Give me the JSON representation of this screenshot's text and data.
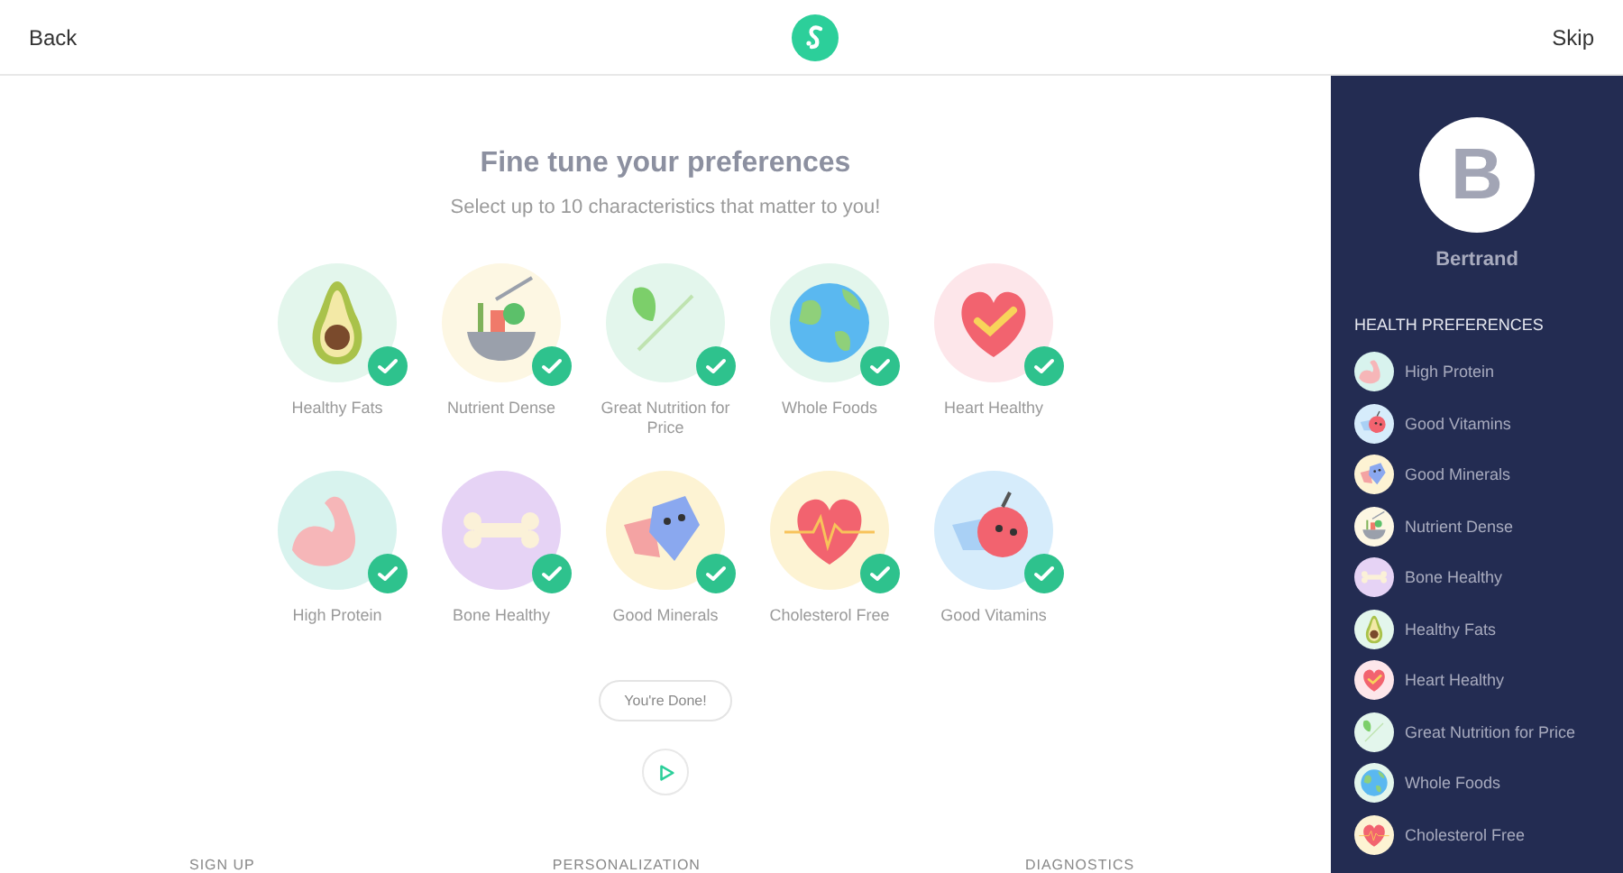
{
  "header": {
    "back": "Back",
    "skip": "Skip"
  },
  "main": {
    "title": "Fine tune your preferences",
    "subtitle": "Select up to 10 characteristics that matter to you!",
    "options": [
      {
        "label": "Healthy Fats",
        "kind": "avocado",
        "selected": true
      },
      {
        "label": "Nutrient Dense",
        "kind": "salad",
        "selected": true
      },
      {
        "label": "Great Nutrition for Price",
        "kind": "greens",
        "selected": true
      },
      {
        "label": "Whole Foods",
        "kind": "globe",
        "selected": true
      },
      {
        "label": "Heart Healthy",
        "kind": "heart",
        "selected": true
      },
      {
        "label": "High Protein",
        "kind": "arm",
        "selected": true
      },
      {
        "label": "Bone Healthy",
        "kind": "bone",
        "selected": true
      },
      {
        "label": "Good Minerals",
        "kind": "gem",
        "selected": true
      },
      {
        "label": "Cholesterol Free",
        "kind": "pulse",
        "selected": true
      },
      {
        "label": "Good Vitamins",
        "kind": "apple",
        "selected": true
      }
    ],
    "done_button": "You're Done!",
    "footer": [
      "SIGN UP",
      "PERSONALIZATION",
      "DIAGNOSTICS"
    ]
  },
  "sidebar": {
    "avatar_initial": "B",
    "name": "Bertrand",
    "heading": "HEALTH PREFERENCES",
    "items": [
      {
        "label": "High Protein",
        "kind": "arm"
      },
      {
        "label": "Good Vitamins",
        "kind": "apple"
      },
      {
        "label": "Good Minerals",
        "kind": "gem"
      },
      {
        "label": "Nutrient Dense",
        "kind": "salad"
      },
      {
        "label": "Bone Healthy",
        "kind": "bone"
      },
      {
        "label": "Healthy Fats",
        "kind": "avocado"
      },
      {
        "label": "Heart Healthy",
        "kind": "heart"
      },
      {
        "label": "Great Nutrition for Price",
        "kind": "greens"
      },
      {
        "label": "Whole Foods",
        "kind": "globe"
      },
      {
        "label": "Cholesterol Free",
        "kind": "pulse"
      }
    ]
  }
}
